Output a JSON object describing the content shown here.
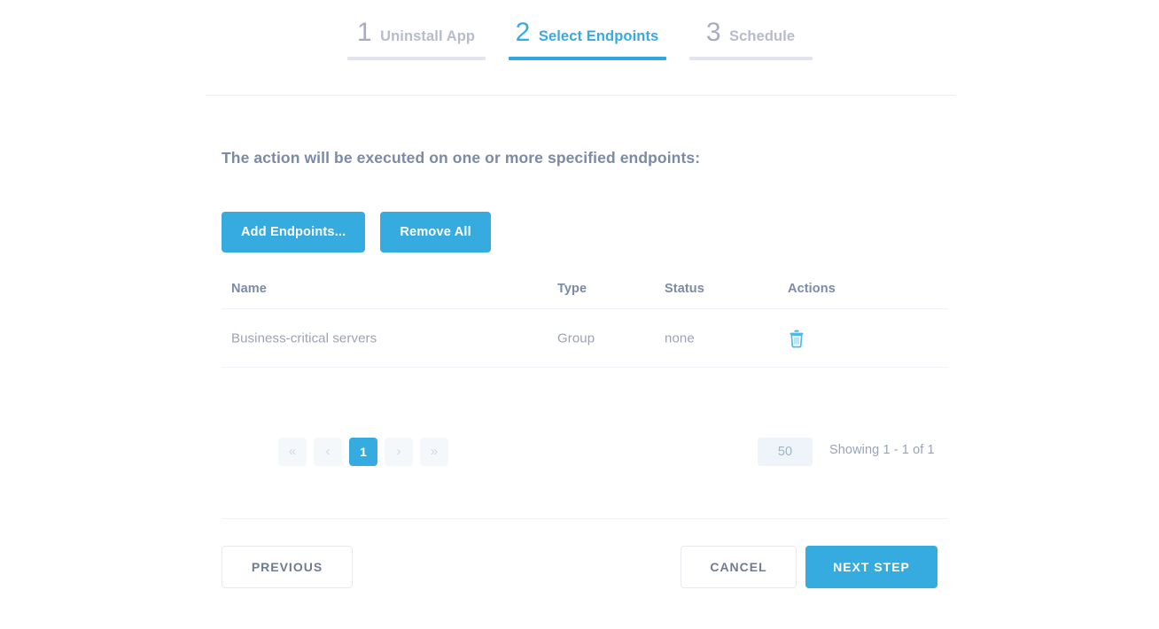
{
  "wizard": {
    "steps": [
      {
        "number": "1",
        "label": "Uninstall App",
        "state": "inactive"
      },
      {
        "number": "2",
        "label": "Select Endpoints",
        "state": "active"
      },
      {
        "number": "3",
        "label": "Schedule",
        "state": "inactive"
      }
    ]
  },
  "main": {
    "instruction": "The action will be executed on one or more specified endpoints:",
    "add_endpoints_label": "Add Endpoints...",
    "remove_all_label": "Remove All"
  },
  "table": {
    "columns": [
      "Name",
      "Type",
      "Status",
      "Actions"
    ],
    "rows": [
      {
        "name": "Business-critical servers",
        "type": "Group",
        "status": "none",
        "action_icon": "trash-icon"
      }
    ]
  },
  "pagination": {
    "buttons": [
      {
        "label": "«",
        "name": "first-page",
        "current": false
      },
      {
        "label": "‹",
        "name": "previous-page",
        "current": false
      },
      {
        "label": "1",
        "name": "page-1",
        "current": true
      },
      {
        "label": "›",
        "name": "next-page",
        "current": false
      },
      {
        "label": "»",
        "name": "last-page",
        "current": false
      }
    ],
    "page_size": "50",
    "showing": "Showing 1 - 1 of 1"
  },
  "footer": {
    "previous_label": "PREVIOUS",
    "cancel_label": "CANCEL",
    "next_step_label": "NEXT STEP"
  },
  "colors": {
    "accent_blue": "#35abe0",
    "muted_text": "#9aa3b5",
    "heading_text": "#7b8aa6",
    "inactive_step": "#b7bccd"
  }
}
